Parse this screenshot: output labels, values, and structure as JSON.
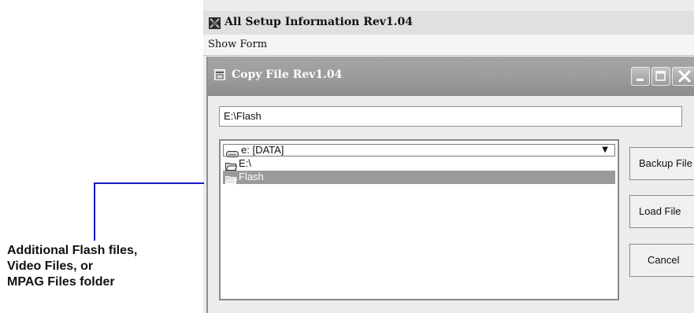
{
  "outer_window": {
    "title": "All Setup Information Rev1.04",
    "menu": [
      "Show Form"
    ]
  },
  "dialog": {
    "title": "Copy File Rev1.04",
    "path_value": "E:\\Flash",
    "drive_select": "e: [DATA]",
    "folders": [
      {
        "label": "E:\\",
        "selected": false
      },
      {
        "label": "Flash",
        "selected": true
      }
    ],
    "buttons": {
      "backup": "Backup File",
      "load": "Load File",
      "cancel": "Cancel"
    }
  },
  "annotation": {
    "lines": [
      "Additional Flash files,",
      "Video Files, or",
      "MPAG Files folder"
    ],
    "line_color": "#1515c8"
  },
  "colors": {
    "selection": "#9a9a9a",
    "dialog_title_bar": "#9a9a9a"
  }
}
